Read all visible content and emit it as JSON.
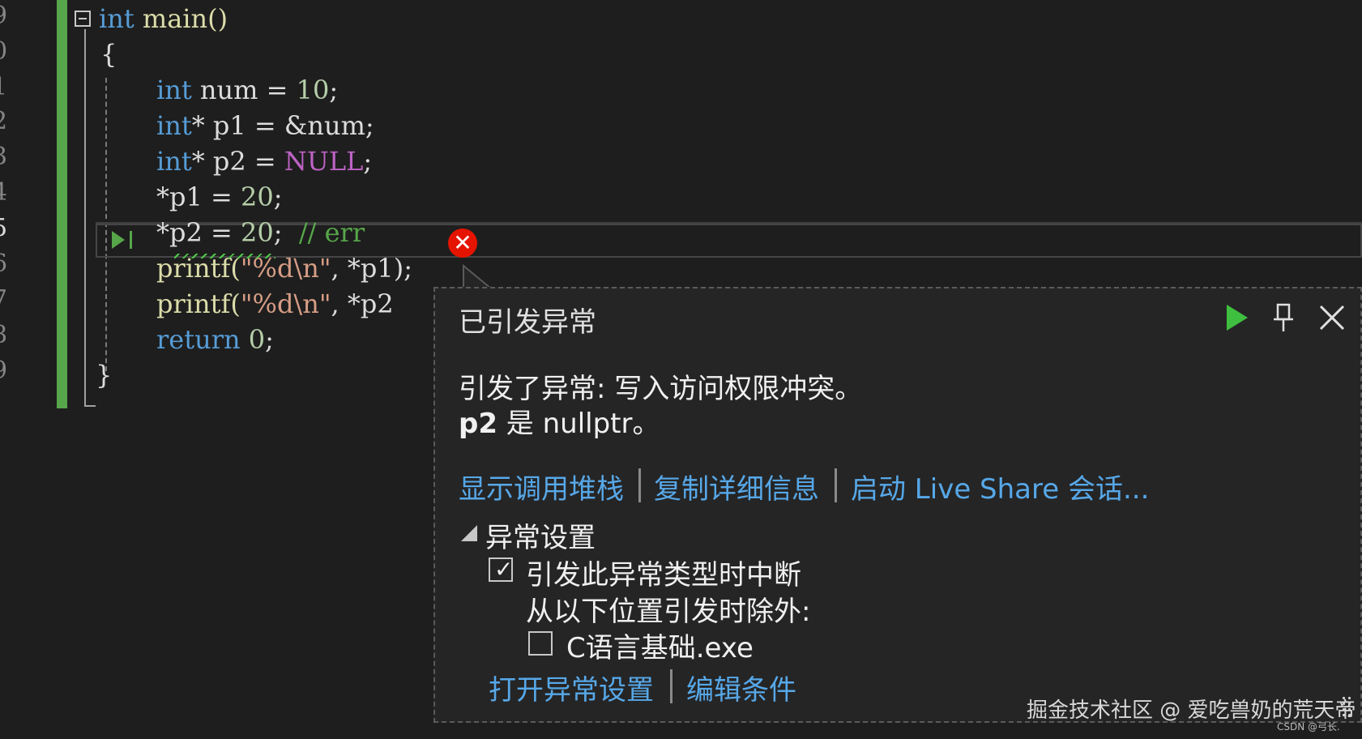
{
  "gutter": {
    "line_numbers": [
      "9",
      "0",
      "1",
      "2",
      "3",
      "4",
      "5",
      "6",
      "7",
      "8",
      "9"
    ],
    "current_index": 6
  },
  "code": {
    "l1": {
      "kw": "int",
      "rest": " main()"
    },
    "l2": {
      "text": "{"
    },
    "l3": {
      "kw": "int",
      "name": " num = ",
      "num": "10",
      "end": ";"
    },
    "l4": {
      "kw": "int",
      "name": "* p1 = &num;"
    },
    "l5": {
      "kw": "int",
      "name": "* p2 = ",
      "macro": "NULL",
      "end": ";"
    },
    "l6": {
      "name": "*p1 = ",
      "num": "20",
      "end": ";"
    },
    "l7": {
      "name": "*p2 = ",
      "num": "20",
      "end": ";  ",
      "comment": "// err"
    },
    "l8": {
      "fn": "printf(",
      "str": "\"%d\\n\"",
      "rest": ", *p1);"
    },
    "l9": {
      "fn": "printf(",
      "str": "\"%d\\n\"",
      "rest": ", *p2"
    },
    "l10": {
      "kw": "return",
      "rest": " ",
      "num": "0",
      "end": ";"
    },
    "l11": {
      "text": "}"
    }
  },
  "popup": {
    "title": "已引发异常",
    "message_line1": "引发了异常: 写入访问权限冲突。",
    "message_var": "p2",
    "message_rest": " 是 nullptr。",
    "links": {
      "call_stack": "显示调用堆栈",
      "copy_details": "复制详细信息",
      "live_share": "启动 Live Share 会话..."
    },
    "settings_header": "异常设置",
    "break_when_thrown": "引发此异常类型时中断",
    "break_when_thrown_checked": true,
    "except_from": "从以下位置引发时除外:",
    "module": "C语言基础.exe",
    "module_checked": false,
    "open_settings": "打开异常设置",
    "edit_conditions": "编辑条件"
  },
  "watermark": {
    "main": "掘金技术社区 @ 爱吃兽奶的荒天帝",
    "small": "CSDN @弓长."
  },
  "colors": {
    "background": "#1e1e1e",
    "keyword": "#569cd6",
    "number": "#b5cea8",
    "string": "#d69d85",
    "comment": "#57a64a",
    "link": "#57a8e8",
    "error": "#e51400",
    "continue": "#3fbf3f"
  }
}
